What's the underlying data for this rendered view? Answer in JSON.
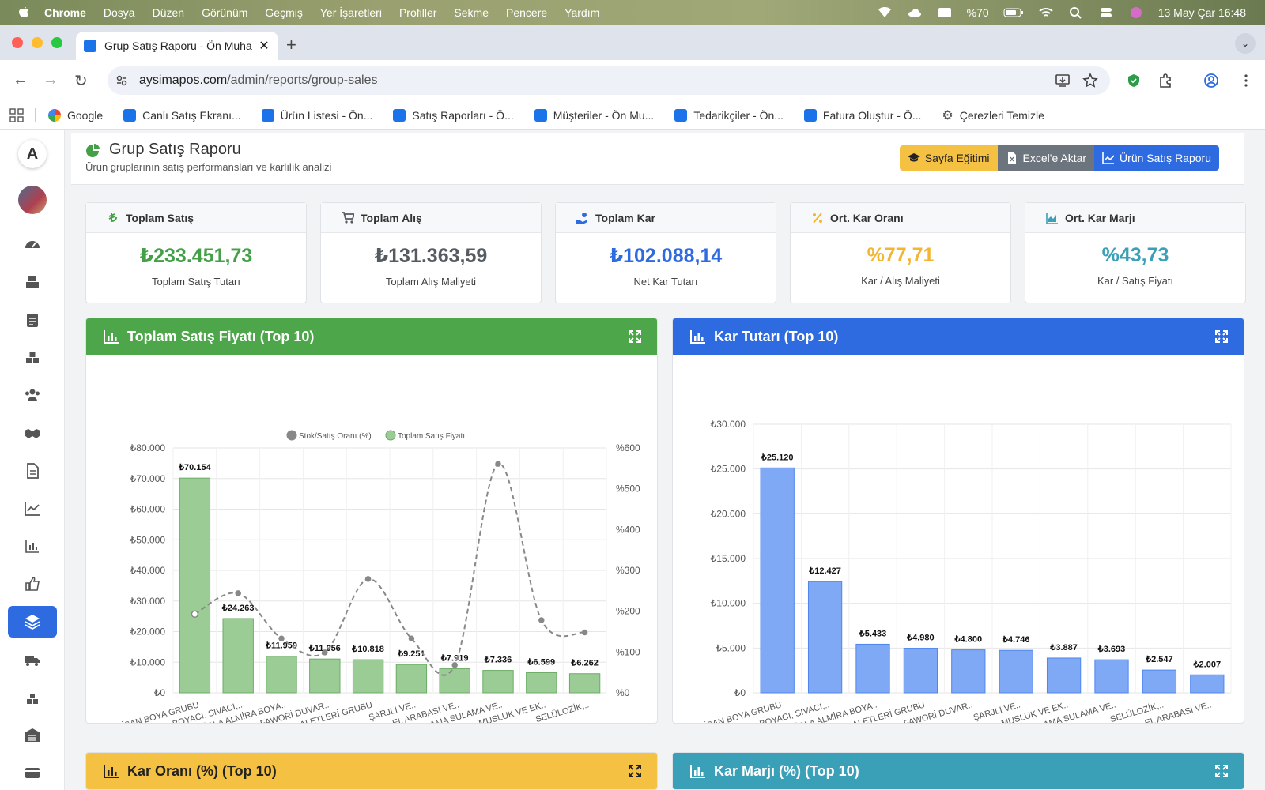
{
  "os_menubar": {
    "app": "Chrome",
    "items": [
      "Dosya",
      "Düzen",
      "Görünüm",
      "Geçmiş",
      "Yer İşaretleri",
      "Profiller",
      "Sekme",
      "Pencere",
      "Yardım"
    ],
    "battery": "%70",
    "datetime": "13 May Çar  16:48"
  },
  "browser": {
    "tab_title": "Grup Satış Raporu - Ön Muha",
    "url_host": "aysimapos.com",
    "url_path": "/admin/reports/group-sales",
    "bookmarks": [
      "Google",
      "Canlı Satış Ekranı...",
      "Ürün Listesi - Ön...",
      "Satış Raporları - Ö...",
      "Müşteriler - Ön Mu...",
      "Tedarikçiler - Ön...",
      "Fatura Oluştur - Ö...",
      "Çerezleri Temizle"
    ]
  },
  "sidebar": {
    "logo_letter": "A",
    "items": [
      "dashboard-icon",
      "cash-register-icon",
      "clipboard-icon",
      "boxes-icon",
      "users-icon",
      "handshake-icon",
      "document-icon",
      "line-chart-icon",
      "bar-chart-icon",
      "thumbs-up-icon",
      "layers-icon",
      "truck-icon",
      "warehouse-boxes-icon",
      "building-icon",
      "card-icon"
    ],
    "active_index": 10
  },
  "page": {
    "title": "Grup Satış Raporu",
    "subtitle": "Ürün gruplarının satış performansları ve karlılık analizi",
    "buttons": {
      "training": "Sayfa Eğitimi",
      "excel": "Excel'e Aktar",
      "product_report": "Ürün Satış Raporu"
    }
  },
  "stats": [
    {
      "title": "Toplam Satış",
      "value": "₺233.451,73",
      "label": "Toplam Satış Tutarı",
      "color": "#43a047"
    },
    {
      "title": "Toplam Alış",
      "value": "₺131.363,59",
      "label": "Toplam Alış Maliyeti",
      "color": "#555b61"
    },
    {
      "title": "Toplam Kar",
      "value": "₺102.088,14",
      "label": "Net Kar Tutarı",
      "color": "#2f6be0"
    },
    {
      "title": "Ort. Kar Oranı",
      "value": "%77,71",
      "label": "Kar / Alış Maliyeti",
      "color": "#f2b632"
    },
    {
      "title": "Ort. Kar Marjı",
      "value": "%43,73",
      "label": "Kar / Satış Fiyatı",
      "color": "#3aa0b8"
    }
  ],
  "cards": {
    "sales": {
      "title": "Toplam Satış Fiyatı (Top 10)",
      "color": "#4ea64a"
    },
    "profit": {
      "title": "Kar Tutarı (Top 10)",
      "color": "#2f6be0"
    },
    "profit_rate": {
      "title": "Kar Oranı (%) (Top 10)",
      "color": "#f5c142"
    },
    "profit_margin": {
      "title": "Kar Marjı (%) (Top 10)",
      "color": "#3aa0b8"
    }
  },
  "chart_data": [
    {
      "type": "bar",
      "title": "Toplam Satış Fiyatı (Top 10)",
      "categories": [
        "POLİSAN BOYA GRUBU",
        "BOYACI, SIVACI,..",
        "VİOLA ALMİRA BOYA..",
        "FAWORİ DUVAR..",
        "EL ALETLERİ GRUBU",
        "ŞARJLI VE..",
        "EL ARABASI VE..",
        "DAMLAMA SULAMA VE..",
        "MUSLUK VE EK..",
        "SELÜLOZİK,.."
      ],
      "series": [
        {
          "name": "Toplam Satış Fiyatı",
          "type": "bar",
          "axis": "left",
          "values": [
            70154,
            24263,
            11959,
            11056,
            10818,
            9251,
            7919,
            7336,
            6599,
            6262
          ],
          "labels": [
            "₺70.154",
            "₺24.263",
            "₺11.959",
            "₺11.056",
            "₺10.818",
            "₺9.251",
            "₺7.919",
            "₺7.336",
            "₺6.599",
            "₺6.262"
          ]
        },
        {
          "name": "Stok/Satış Oranı (%)",
          "type": "line",
          "axis": "right",
          "values": [
            193,
            244,
            133,
            99,
            279,
            133,
            68,
            561,
            178,
            148
          ]
        }
      ],
      "yticks_left": [
        "₺0",
        "₺10.000",
        "₺20.000",
        "₺30.000",
        "₺40.000",
        "₺50.000",
        "₺60.000",
        "₺70.000",
        "₺80.000"
      ],
      "yticks_right": [
        "%0",
        "%100",
        "%200",
        "%300",
        "%400",
        "%500",
        "%600"
      ],
      "ylim": [
        0,
        80000
      ],
      "ylim_right": [
        0,
        600
      ],
      "legend": "top-center",
      "grid": true
    },
    {
      "type": "bar",
      "title": "Kar Tutarı (Top 10)",
      "categories": [
        "POLİSAN BOYA GRUBU",
        "BOYACI, SIVACI,..",
        "VİOLA ALMİRA BOYA..",
        "EL ALETLERİ GRUBU",
        "FAWORİ DUVAR..",
        "ŞARJLI VE..",
        "MUSLUK VE EK..",
        "DAMLAMA SULAMA VE..",
        "SELÜLOZİK,..",
        "EL ARABASI VE.."
      ],
      "series": [
        {
          "name": "",
          "type": "bar",
          "values": [
            25120,
            12427,
            5433,
            4980,
            4800,
            4746,
            3887,
            3693,
            2547,
            2007
          ],
          "labels": [
            "₺25.120",
            "₺12.427",
            "₺5.433",
            "₺4.980",
            "₺4.800",
            "₺4.746",
            "₺3.887",
            "₺3.693",
            "₺2.547",
            "₺2.007"
          ]
        }
      ],
      "yticks_left": [
        "₺0",
        "₺5.000",
        "₺10.000",
        "₺15.000",
        "₺20.000",
        "₺25.000",
        "₺30.000"
      ],
      "ylim": [
        0,
        30000
      ],
      "grid": true
    }
  ]
}
